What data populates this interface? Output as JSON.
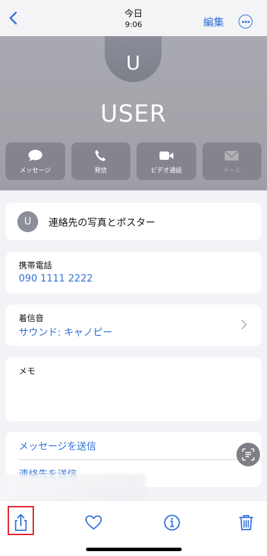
{
  "nav": {
    "title": "今日",
    "subtitle": "9:06",
    "edit_label": "編集"
  },
  "contact": {
    "initial": "U",
    "name": "USER"
  },
  "actions": [
    {
      "label": "メッセージ",
      "icon": "message-icon",
      "enabled": true
    },
    {
      "label": "発信",
      "icon": "phone-icon",
      "enabled": true
    },
    {
      "label": "ビデオ通話",
      "icon": "video-icon",
      "enabled": true
    },
    {
      "label": "メール",
      "icon": "mail-icon",
      "enabled": false
    }
  ],
  "photo_poster": {
    "initial": "U",
    "label": "連絡先の写真とポスター"
  },
  "mobile": {
    "label": "携帯電話",
    "value": "090 1111 2222"
  },
  "ringtone": {
    "label": "着信音",
    "value": "サウンド: キャノピー"
  },
  "memo": {
    "label": "メモ"
  },
  "links": {
    "send_message": "メッセージを送信",
    "share_contact": "連絡先を送信"
  },
  "toolbar": {
    "share_icon": "share-icon",
    "favorite_icon": "heart-icon",
    "info_icon": "info-icon",
    "delete_icon": "trash-icon"
  },
  "colors": {
    "accent": "#2f6fd8",
    "highlight": "#e3212b"
  }
}
